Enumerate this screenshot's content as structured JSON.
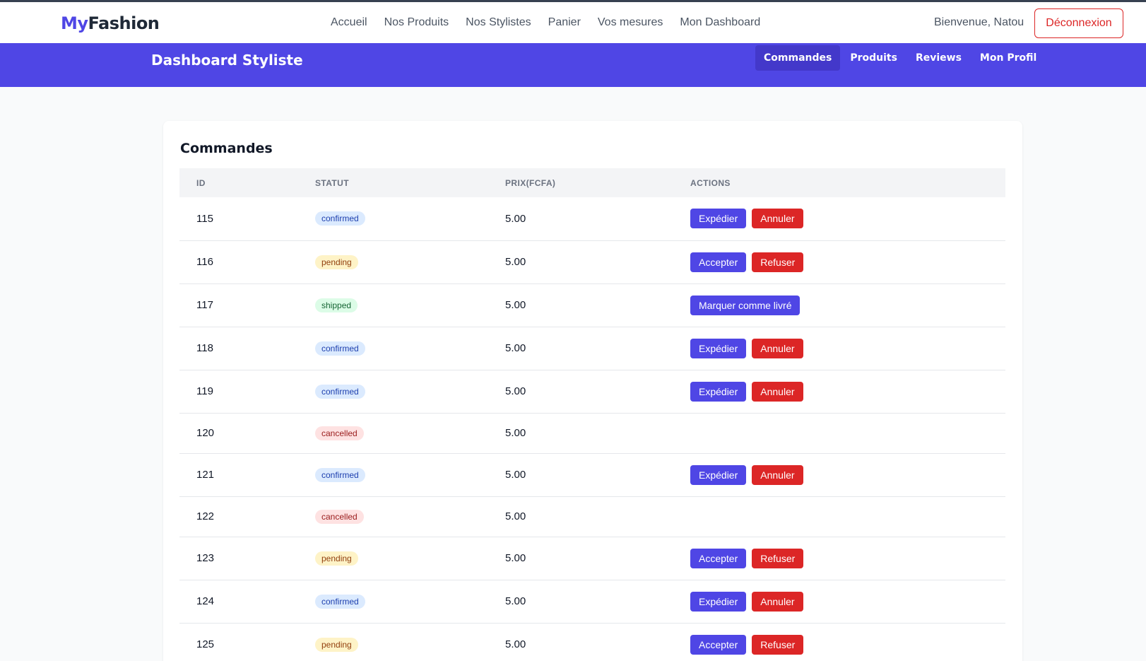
{
  "navbar": {
    "logo_part1": "My",
    "logo_part2": "Fashion",
    "links": [
      "Accueil",
      "Nos Produits",
      "Nos Stylistes",
      "Panier",
      "Vos mesures",
      "Mon Dashboard"
    ],
    "welcome": "Bienvenue, Natou",
    "logout": "Déconnexion"
  },
  "dashboard": {
    "title": "Dashboard Styliste",
    "tabs": [
      "Commandes",
      "Produits",
      "Reviews",
      "Mon Profil"
    ],
    "active_tab": "Commandes"
  },
  "orders": {
    "heading": "Commandes",
    "columns": [
      "ID",
      "STATUT",
      "PRIX(FCFA)",
      "ACTIONS"
    ],
    "rows": [
      {
        "id": "115",
        "status": "confirmed",
        "price": "5.00",
        "actions": [
          "Expédier",
          "Annuler"
        ]
      },
      {
        "id": "116",
        "status": "pending",
        "price": "5.00",
        "actions": [
          "Accepter",
          "Refuser"
        ]
      },
      {
        "id": "117",
        "status": "shipped",
        "price": "5.00",
        "actions": [
          "Marquer comme livré"
        ]
      },
      {
        "id": "118",
        "status": "confirmed",
        "price": "5.00",
        "actions": [
          "Expédier",
          "Annuler"
        ]
      },
      {
        "id": "119",
        "status": "confirmed",
        "price": "5.00",
        "actions": [
          "Expédier",
          "Annuler"
        ]
      },
      {
        "id": "120",
        "status": "cancelled",
        "price": "5.00",
        "actions": []
      },
      {
        "id": "121",
        "status": "confirmed",
        "price": "5.00",
        "actions": [
          "Expédier",
          "Annuler"
        ]
      },
      {
        "id": "122",
        "status": "cancelled",
        "price": "5.00",
        "actions": []
      },
      {
        "id": "123",
        "status": "pending",
        "price": "5.00",
        "actions": [
          "Accepter",
          "Refuser"
        ]
      },
      {
        "id": "124",
        "status": "confirmed",
        "price": "5.00",
        "actions": [
          "Expédier",
          "Annuler"
        ]
      },
      {
        "id": "125",
        "status": "pending",
        "price": "5.00",
        "actions": [
          "Accepter",
          "Refuser"
        ]
      }
    ]
  },
  "colors": {
    "brand": "#4f46e5",
    "danger": "#dc2626",
    "confirmed_bg": "#dbeafe",
    "pending_bg": "#fef3c7",
    "shipped_bg": "#dcfce7",
    "cancelled_bg": "#fee2e2"
  }
}
